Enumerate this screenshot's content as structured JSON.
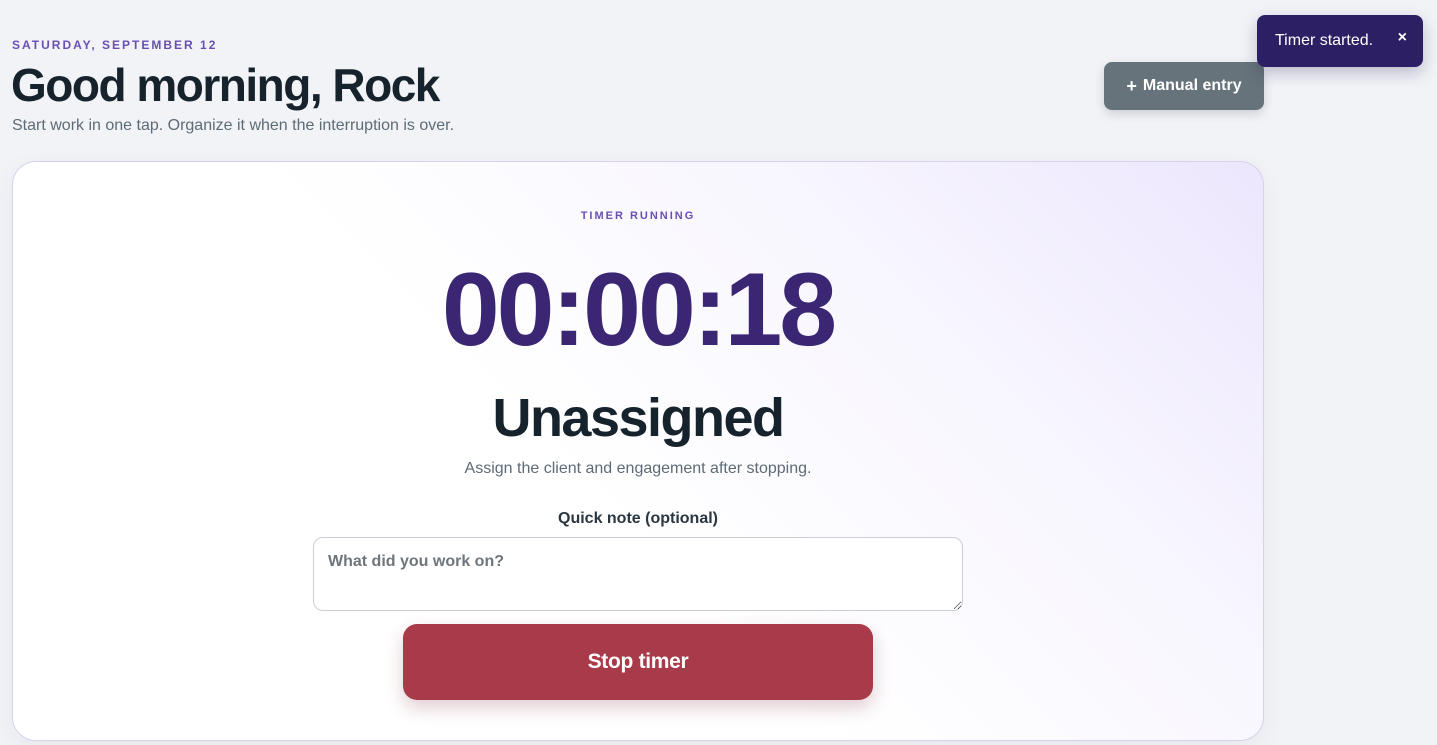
{
  "header": {
    "date": "SATURDAY, SEPTEMBER 12",
    "greeting": "Good morning, Rock",
    "subtitle": "Start work in one tap. Organize it when the interruption is over."
  },
  "actions": {
    "manual_entry_icon": "+",
    "manual_entry_label": "Manual entry"
  },
  "toast": {
    "message": "Timer started.",
    "close_glyph": "×"
  },
  "timer": {
    "status": "TIMER RUNNING",
    "elapsed": "00:00:18",
    "assignment": "Unassigned",
    "assignment_hint": "Assign the client and engagement after stopping.",
    "note_label": "Quick note (optional)",
    "note_placeholder": "What did you work on?",
    "note_value": "",
    "stop_label": "Stop timer"
  },
  "colors": {
    "accent": "#6a4fb3",
    "timer": "#3a2673",
    "stop_button": "#a93a4a",
    "toast_bg": "#2d1f63",
    "secondary_button": "#66737b"
  }
}
